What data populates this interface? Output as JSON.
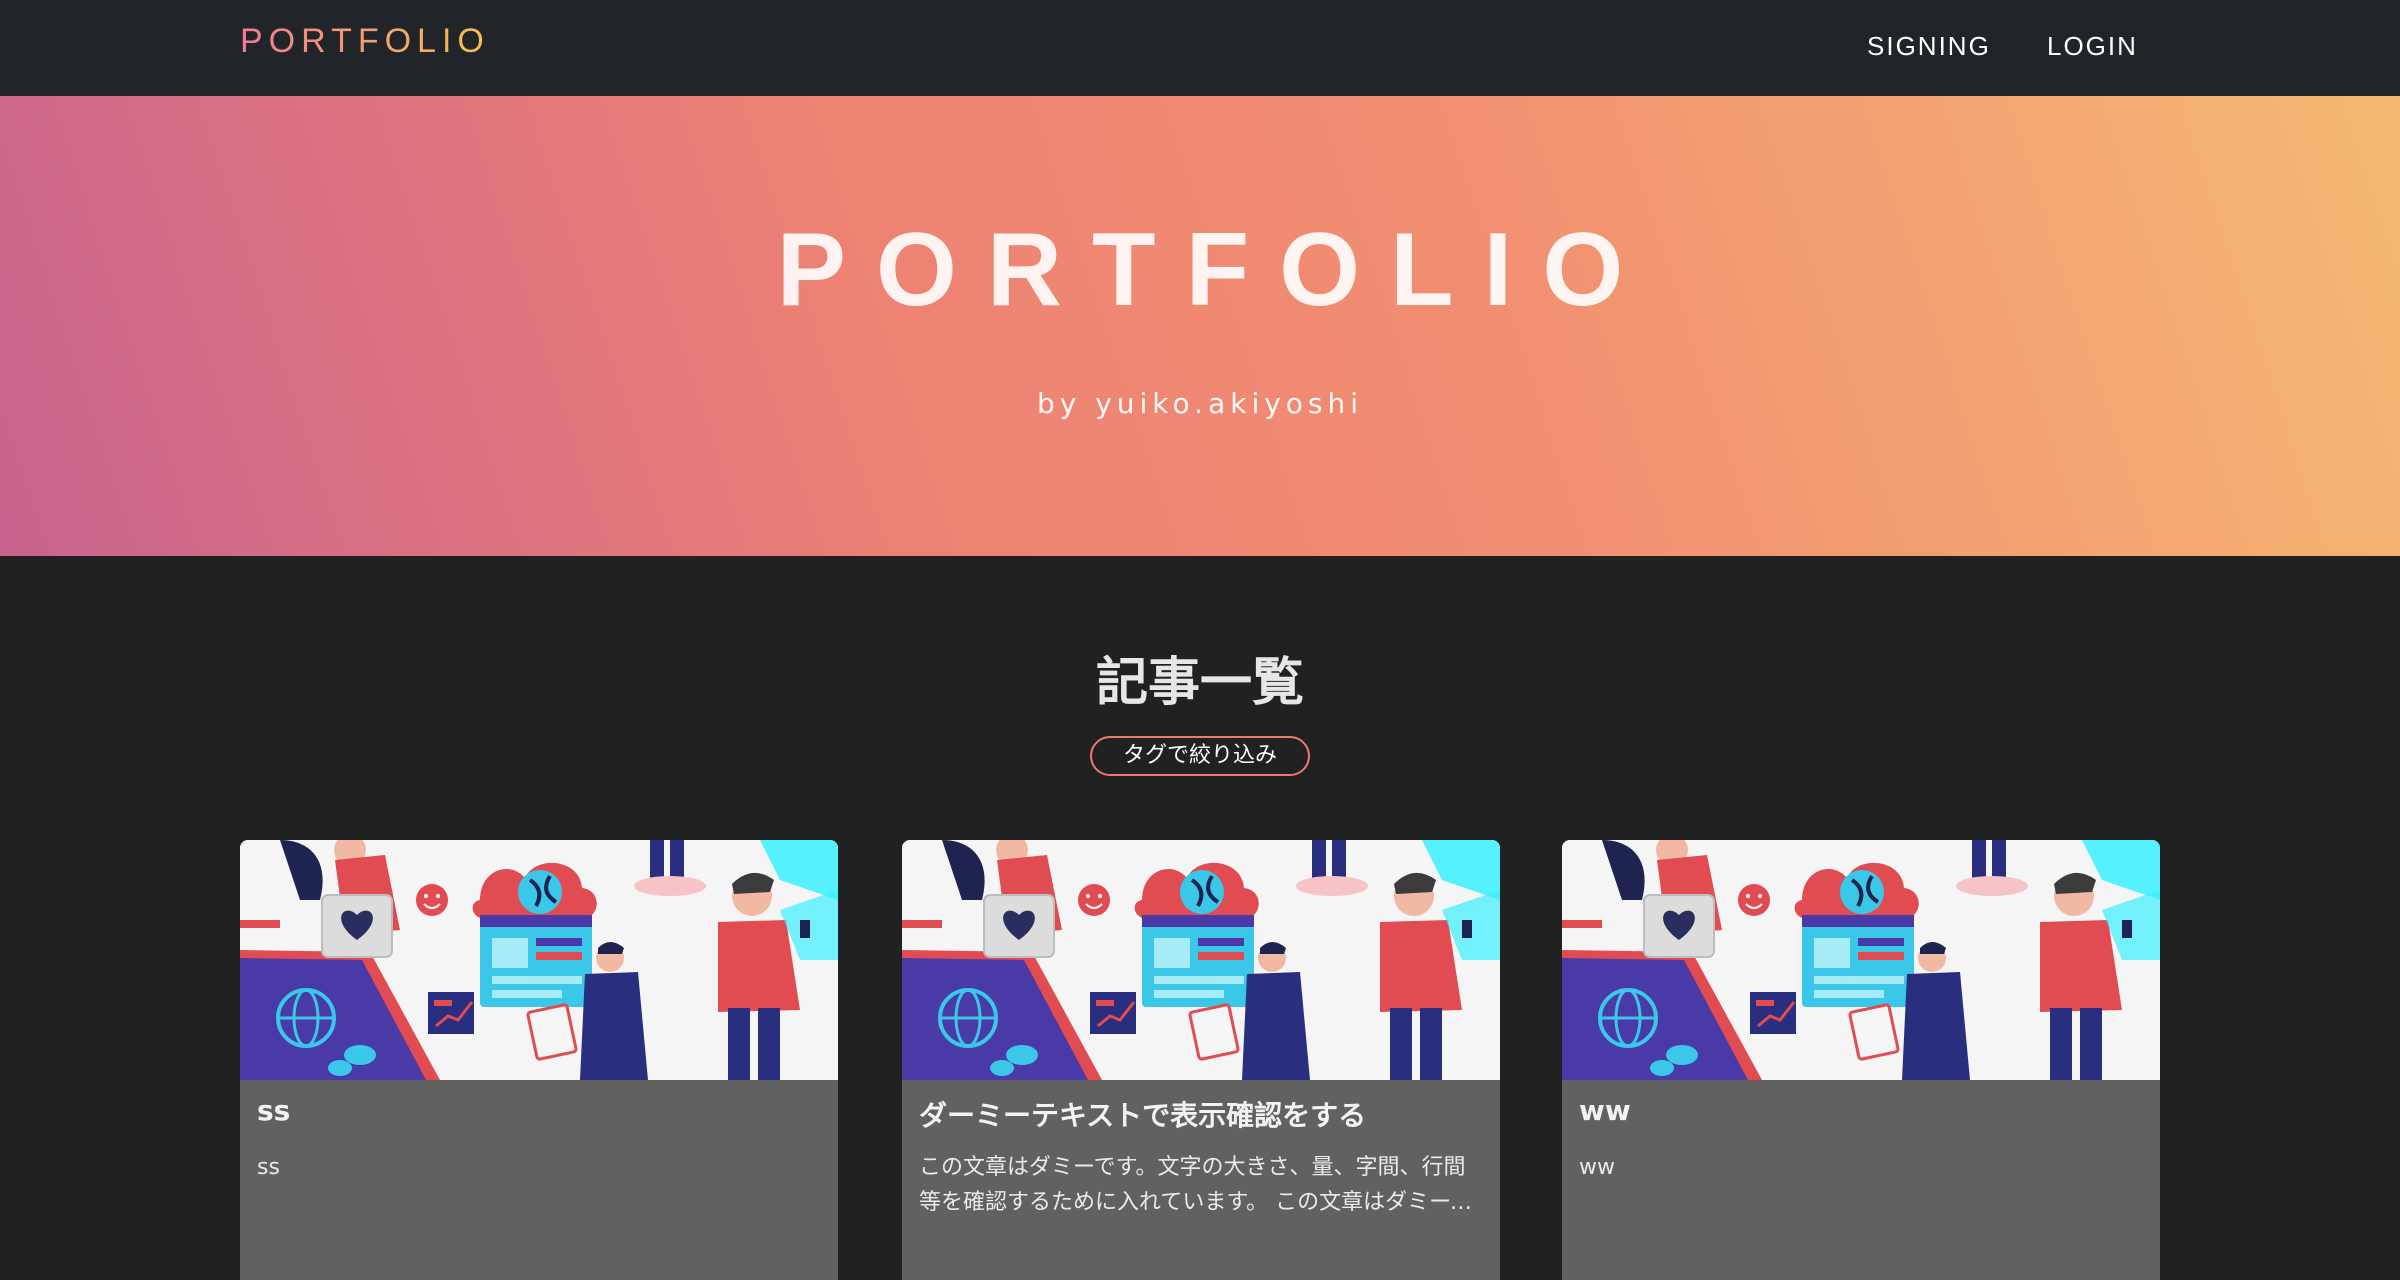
{
  "navbar": {
    "brand": "PORTFOLIO",
    "links": [
      "SIGNING",
      "LOGIN"
    ]
  },
  "hero": {
    "title": "PORTFOLIO",
    "subtitle": "by yuiko.akiyoshi"
  },
  "articles": {
    "heading": "記事一覧",
    "tag_filter_label": "タグで絞り込み",
    "items": [
      {
        "title": "ss",
        "excerpt": "ss"
      },
      {
        "title": "ダーミーテキストで表示確認をする",
        "excerpt": "この文章はダミーです。文字の大きさ、量、字間、行間等を確認するために入れています。 この文章はダミーです。文字の大きさ、量、字間、行間等を確認するために入れています。"
      },
      {
        "title": "ww",
        "excerpt": "ww"
      }
    ]
  },
  "colors": {
    "navbar_bg": "#212428",
    "page_bg": "#212121",
    "card_body_bg": "#616161",
    "accent_pink": "#f07a95",
    "accent_yellow": "#f5c04b",
    "tag_border": "#f0776f"
  },
  "icons": {
    "card_image": "business-people-illustration"
  }
}
